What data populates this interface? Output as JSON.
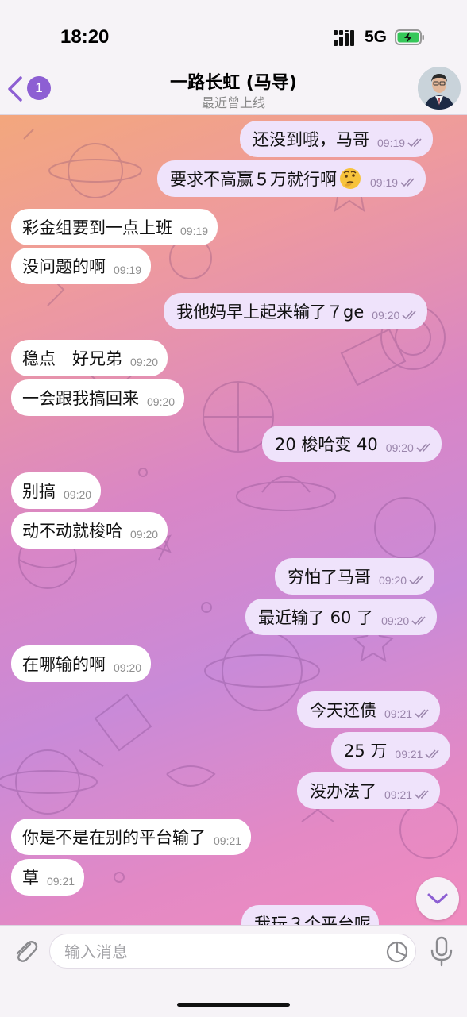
{
  "status_bar": {
    "time": "18:20",
    "network": "5G"
  },
  "header": {
    "back_badge": "1",
    "title": "一路长虹 (马导)",
    "subtitle": "最近曾上线"
  },
  "messages": [
    {
      "dir": "out",
      "text": "还没到哦，马哥",
      "time": "09:19"
    },
    {
      "dir": "out",
      "text": "要求不高赢５万就行啊",
      "time": "09:19",
      "emoji": "thinking-face-icon"
    },
    {
      "dir": "in",
      "text": "彩金组要到一点上班",
      "time": "09:19"
    },
    {
      "dir": "in",
      "text": "没问题的啊",
      "time": "09:19"
    },
    {
      "dir": "out",
      "text": "我他妈早上起来输了７ge",
      "time": "09:20"
    },
    {
      "dir": "in",
      "text": "稳点　好兄弟",
      "time": "09:20"
    },
    {
      "dir": "in",
      "text": "一会跟我搞回来",
      "time": "09:20"
    },
    {
      "dir": "out",
      "text": "20 梭哈变 40",
      "time": "09:20"
    },
    {
      "dir": "in",
      "text": "别搞",
      "time": "09:20"
    },
    {
      "dir": "in",
      "text": "动不动就梭哈",
      "time": "09:20"
    },
    {
      "dir": "out",
      "text": "穷怕了马哥",
      "time": "09:20"
    },
    {
      "dir": "out",
      "text": "最近输了 60 了",
      "time": "09:20"
    },
    {
      "dir": "in",
      "text": "在哪输的啊",
      "time": "09:20"
    },
    {
      "dir": "out",
      "text": "今天还债",
      "time": "09:21"
    },
    {
      "dir": "out",
      "text": "25 万",
      "time": "09:21"
    },
    {
      "dir": "out",
      "text": "没办法了",
      "time": "09:21"
    },
    {
      "dir": "in",
      "text": "你是不是在别的平台输了",
      "time": "09:21"
    },
    {
      "dir": "in",
      "text": "草",
      "time": "09:21"
    },
    {
      "dir": "out",
      "text": "我玩３个平台呢",
      "time": ""
    }
  ],
  "input": {
    "placeholder": "输入消息"
  },
  "colors": {
    "accent": "#8d5fd3",
    "outgoing_bubble": "#efe3fb",
    "incoming_bubble": "#ffffff"
  }
}
